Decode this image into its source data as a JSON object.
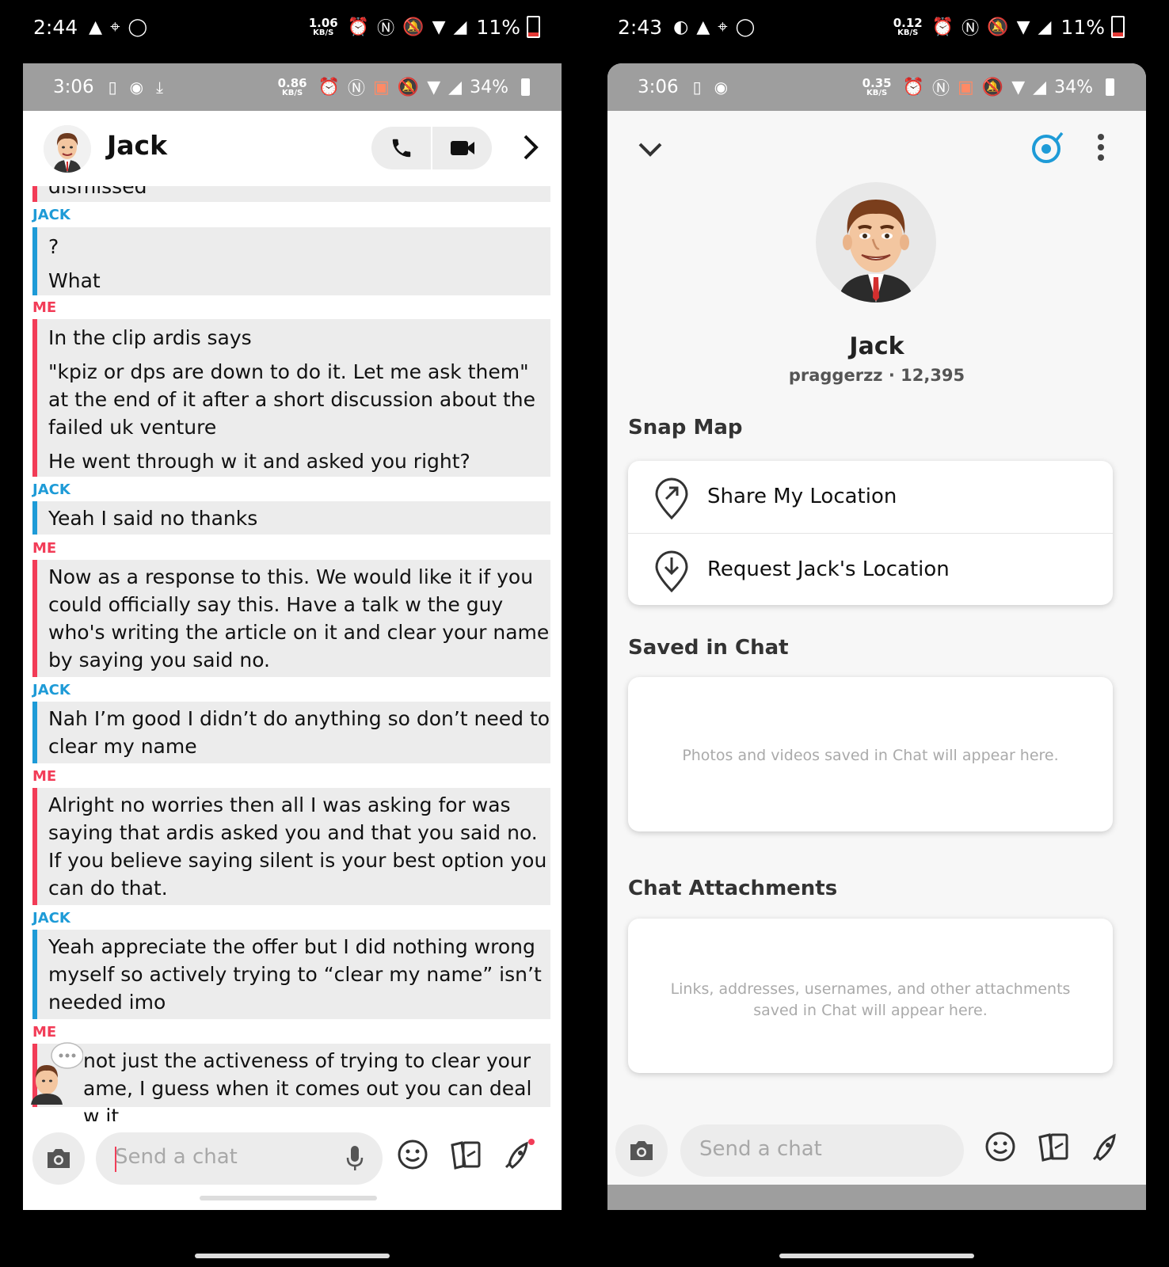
{
  "left": {
    "outer_status": {
      "time": "2:44",
      "speed_value": "1.06",
      "speed_unit": "KB/S",
      "battery": "11%"
    },
    "inner_status": {
      "time": "3:06",
      "speed_value": "0.86",
      "speed_unit": "KB/S",
      "battery": "34%"
    },
    "header": {
      "name": "Jack"
    },
    "messages": {
      "partial_top": "dismissed",
      "m1": {
        "sender": "JACK",
        "lines": [
          "?",
          "What"
        ]
      },
      "m2": {
        "sender": "ME",
        "lines": [
          "In the clip ardis says",
          "\"kpiz or dps are down to do it. Let me ask them\" at the end of it after a short discussion about the failed uk venture",
          "He went through w it and asked you right?"
        ]
      },
      "m3": {
        "sender": "JACK",
        "lines": [
          "Yeah I said no thanks"
        ]
      },
      "m4": {
        "sender": "ME",
        "lines": [
          "Now as a response to this. We would like it if you could officially say this. Have a talk w the guy who's writing the article on it and clear your name by saying you said no."
        ]
      },
      "m5": {
        "sender": "JACK",
        "lines": [
          "Nah I’m good I didn’t do anything so don’t need to clear my name"
        ]
      },
      "m6": {
        "sender": "ME",
        "lines": [
          "Alright no worries then all I was asking for was saying that ardis asked you and that you said no. If you believe saying silent is your best option you can do that."
        ]
      },
      "m7": {
        "sender": "JACK",
        "lines": [
          "Yeah appreciate the offer but I did nothing wrong myself so actively trying to “clear my name” isn’t needed imo"
        ]
      },
      "m8": {
        "sender": "ME",
        "lines": [
          "not just the activeness of trying to clear your",
          "ame, I guess when it comes out you can deal w it"
        ]
      }
    },
    "composer": {
      "placeholder": "Send a chat"
    }
  },
  "right": {
    "outer_status": {
      "time": "2:43",
      "speed_value": "0.12",
      "speed_unit": "KB/S",
      "battery": "11%"
    },
    "inner_status": {
      "time": "3:06",
      "speed_value": "0.35",
      "speed_unit": "KB/S",
      "battery": "34%"
    },
    "profile": {
      "name": "Jack",
      "subtitle": "praggerzz · 12,395"
    },
    "snap_map": {
      "title": "Snap Map",
      "share": "Share My Location",
      "request": "Request Jack's Location"
    },
    "saved": {
      "title": "Saved in Chat",
      "empty": "Photos and videos saved in Chat will appear here."
    },
    "attachments": {
      "title": "Chat Attachments",
      "empty": "Links, addresses, usernames, and other attachments saved in Chat will appear here."
    },
    "composer": {
      "placeholder": "Send a chat"
    }
  },
  "colors": {
    "jack": "#1e9bd7",
    "me": "#f23c57",
    "status_bar": "#9e9e9e",
    "accent": "#1e9bd7"
  }
}
